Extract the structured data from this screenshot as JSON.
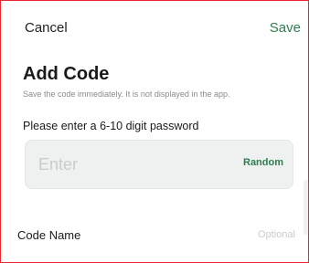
{
  "header": {
    "cancel_label": "Cancel",
    "save_label": "Save"
  },
  "form": {
    "title": "Add Code",
    "subtitle": "Save the code immediately. It is not displayed in the app.",
    "prompt": "Please enter a 6-10 digit password",
    "code_placeholder": "Enter",
    "code_value": "",
    "random_label": "Random",
    "name_label": "Code Name",
    "name_placeholder": "Optional",
    "name_value": ""
  },
  "colors": {
    "accent": "#2e7d4f",
    "frame_border": "#e8262c",
    "field_background": "#eef1ef"
  }
}
